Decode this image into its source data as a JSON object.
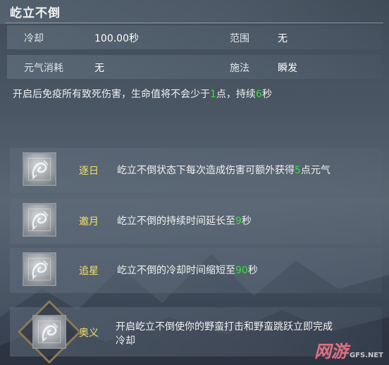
{
  "title": "屹立不倒",
  "stats": {
    "cooldown_label": "冷却",
    "cooldown_value": "100.00秒",
    "range_label": "范围",
    "range_value": "无",
    "energy_label": "元气消耗",
    "energy_value": "无",
    "cast_label": "施法",
    "cast_value": "瞬发"
  },
  "description": {
    "part1": "开启后免疫所有致死伤害，生命值将不会少于",
    "num1": "1",
    "part2": "点，持续",
    "num2": "6",
    "part3": "秒"
  },
  "talents": [
    {
      "name": "逐日",
      "text_a": "屹立不倒状态下每次造成伤害可额外获得",
      "num": "5",
      "text_b": "点元气",
      "icon": "skill-icon"
    },
    {
      "name": "邀月",
      "text_a": "屹立不倒的持续时间延长至",
      "num": "9",
      "text_b": "秒",
      "icon": "skill-icon"
    },
    {
      "name": "追星",
      "text_a": "屹立不倒的冷却时间缩短至",
      "num": "90",
      "text_b": "秒",
      "icon": "skill-icon"
    },
    {
      "name": "奥义",
      "line1": "开启屹立不倒使你的野蛮打击和野蛮跳跃立即完成",
      "line2": "冷却",
      "icon": "skill-icon"
    }
  ],
  "watermark": {
    "text": "网游",
    "sub": "GFS.NET"
  },
  "colors": {
    "highlight": "#37e337",
    "talent_name": "#f5e06a"
  }
}
